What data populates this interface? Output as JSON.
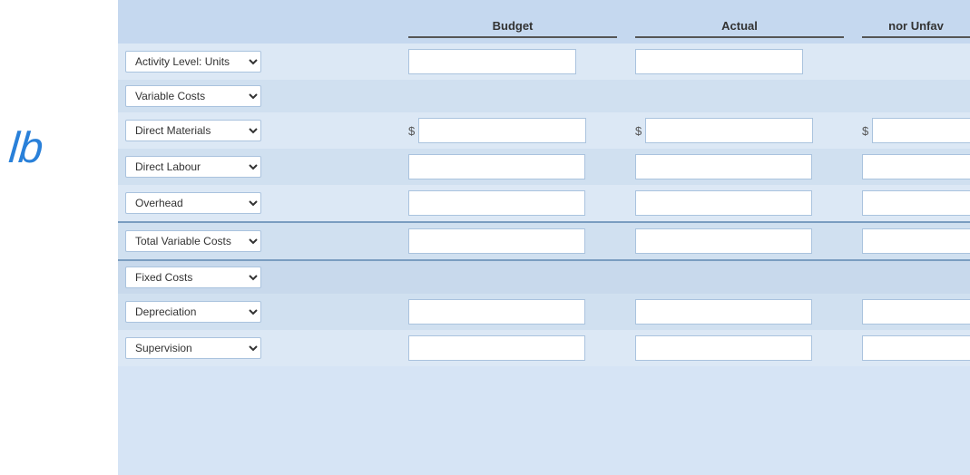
{
  "header": {
    "budget_label": "Budget",
    "actual_label": "Actual",
    "variance_label": "nor Unfav"
  },
  "rows": {
    "activity_level": "Activity Level: Units",
    "variable_costs": "Variable Costs",
    "direct_materials": "Direct Materials",
    "direct_labour": "Direct Labour",
    "overhead": "Overhead",
    "total_variable_costs": "Total Variable Costs",
    "fixed_costs": "Fixed Costs",
    "depreciation": "Depreciation",
    "supervision": "Supervision"
  },
  "dropdowns": {
    "activity_options": [
      "Activity Level: Units"
    ],
    "variable_costs_options": [
      "Variable Costs"
    ],
    "direct_materials_options": [
      "Direct Materials"
    ],
    "direct_labour_options": [
      "Direct Labour"
    ],
    "overhead_options": [
      "Overhead"
    ],
    "total_variable_costs_options": [
      "Total Variable Costs"
    ],
    "fixed_costs_options": [
      "Fixed Costs"
    ],
    "depreciation_options": [
      "Depreciation"
    ],
    "supervision_options": [
      "Supervision"
    ]
  }
}
